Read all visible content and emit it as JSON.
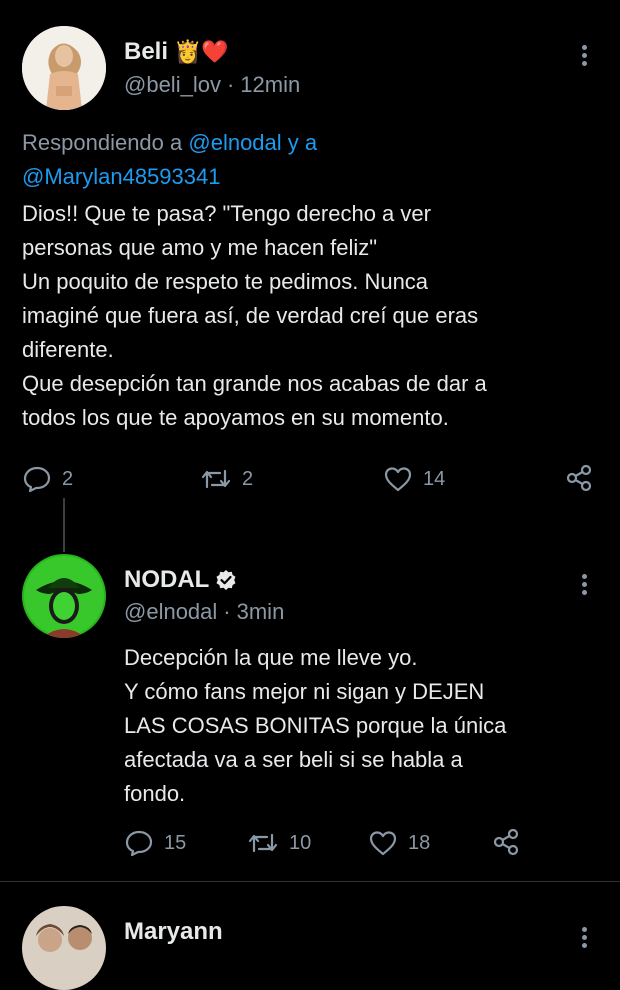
{
  "tweet1": {
    "name": "Beli",
    "emoji": "👸❤️",
    "handle": "@beli_lov",
    "separator": "·",
    "time": "12min",
    "replying_prefix": "Respondiendo a",
    "mention_1": "@elnodal",
    "mention_join": "y a",
    "mention_2": "@Marylan48593341",
    "text": "Dios!! Que te pasa? \"Tengo derecho a ver\npersonas que amo y me hacen feliz\"\nUn poquito de respeto te pedimos. Nunca\nimaginé que fuera así, de verdad creí que eras\ndiferente.\nQue desepción tan grande nos acabas de dar a\ntodos los que te apoyamos en su momento.",
    "replies": "2",
    "retweets": "2",
    "likes": "14"
  },
  "tweet2": {
    "name": "NODAL",
    "handle": "@elnodal",
    "separator": "·",
    "time": "3min",
    "text": "Decepción la que me lleve yo.\n Y cómo fans mejor ni sigan y DEJEN\nLAS COSAS BONITAS porque la única\nafectada va a ser beli si se habla a\nfondo.",
    "replies": "15",
    "retweets": "10",
    "likes": "18"
  },
  "tweet3": {
    "name": "Maryann"
  },
  "icons": {
    "reply": "reply-icon",
    "retweet": "retweet-icon",
    "like": "heart-icon",
    "share": "share-icon",
    "verified": "verified-icon",
    "more": "more-vertical-icon"
  },
  "colors": {
    "background": "#000000",
    "text": "#e7e9ea",
    "muted": "#8b98a5",
    "mention": "#1d9bf0"
  }
}
